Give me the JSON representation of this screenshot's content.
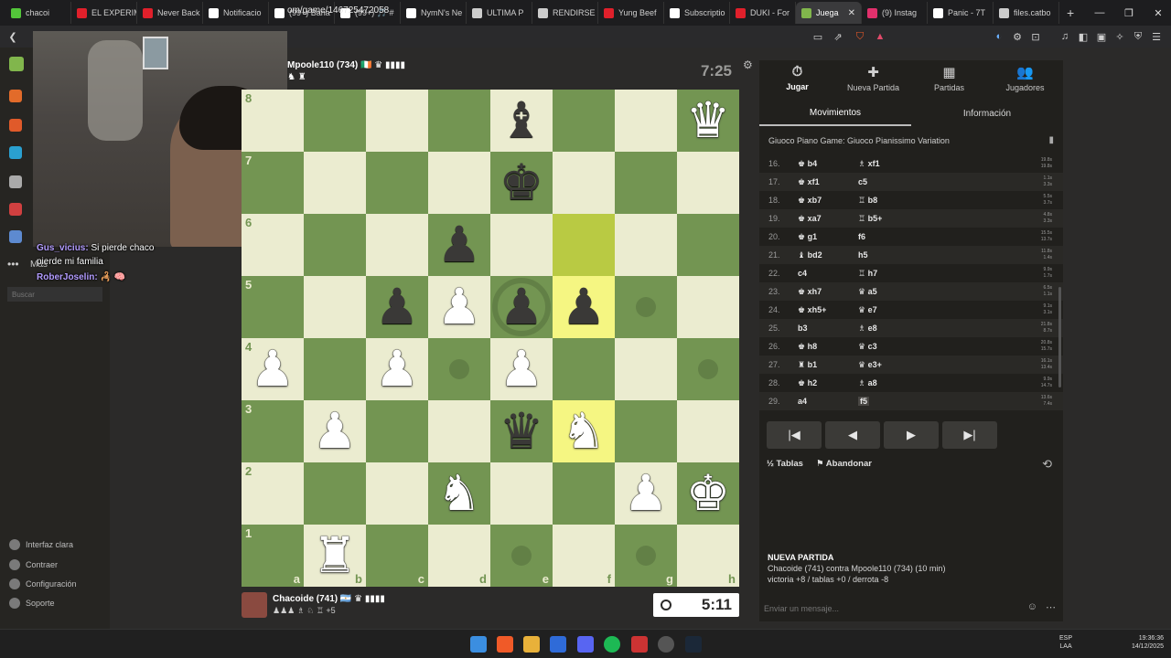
{
  "browser": {
    "tabs": [
      {
        "label": "chacoi",
        "color": "#53c53a"
      },
      {
        "label": "EL EXPERIM",
        "color": "#e0202b"
      },
      {
        "label": "Never Back",
        "color": "#e0202b"
      },
      {
        "label": "Notificacio",
        "color": "#ffffff"
      },
      {
        "label": "(99+) Bana",
        "color": "#ffffff"
      },
      {
        "label": "(99+) 🎵 #",
        "color": "#ffffff"
      },
      {
        "label": "NymN's Ne",
        "color": "#ffffff"
      },
      {
        "label": "ULTIMA P",
        "color": "#cccccc"
      },
      {
        "label": "RENDIRSE",
        "color": "#cccccc"
      },
      {
        "label": "Yung Beef",
        "color": "#e0202b"
      },
      {
        "label": "Subscriptio",
        "color": "#ffffff"
      },
      {
        "label": "DUKI - For",
        "color": "#e0202b"
      },
      {
        "label": "Juega",
        "color": "#81b64c",
        "active": true
      },
      {
        "label": "(9) Instag",
        "color": "#e1306c"
      },
      {
        "label": "Panic - 7T",
        "color": "#ffffff"
      },
      {
        "label": "files.catbo",
        "color": "#cccccc"
      }
    ],
    "url": "om/game/146725472058"
  },
  "stream_chat": [
    {
      "user": "Gus_vicius:",
      "text": "Si pierde chaco"
    },
    {
      "user": "",
      "text": "pierde mi familia"
    },
    {
      "user": "RoberJoselin:",
      "text": "🦂 🧠"
    }
  ],
  "sidebar": {
    "more_label": "Más",
    "search_placeholder": "Buscar",
    "bottom": [
      "Interfaz clara",
      "Contraer",
      "Configuración",
      "Soporte"
    ]
  },
  "opponent": {
    "name": "Mpoole110 (734)",
    "flag": "🇮🇪 ♛ ▮▮▮▮",
    "captured": "♞ ♜",
    "clock": "7:25"
  },
  "player": {
    "name": "Chacoide (741)",
    "flag": "🇦🇷 ♛ ▮▮▮▮",
    "captured": "♟♟♟ ♗ ♘ ♖ +5",
    "clock": "5:11"
  },
  "board": {
    "ranks": [
      "8",
      "7",
      "6",
      "5",
      "4",
      "3",
      "2",
      "1"
    ],
    "files": [
      "a",
      "b",
      "c",
      "d",
      "e",
      "f",
      "g",
      "h"
    ],
    "pieces": [
      [
        "",
        "",
        "",
        "",
        "b-b",
        "",
        "",
        "w-q"
      ],
      [
        "",
        "",
        "",
        "",
        "b-k",
        "",
        "",
        ""
      ],
      [
        "",
        "",
        "",
        "b-p",
        "",
        "",
        "",
        ""
      ],
      [
        "",
        "",
        "b-p",
        "w-p",
        "b-p",
        "b-p",
        "",
        ""
      ],
      [
        "w-p",
        "",
        "w-p",
        "",
        "w-p",
        "",
        "",
        ""
      ],
      [
        "",
        "w-p",
        "",
        "",
        "b-q",
        "w-n",
        "",
        ""
      ],
      [
        "",
        "",
        "",
        "w-n",
        "",
        "",
        "w-p",
        "w-k"
      ],
      [
        "",
        "w-r",
        "",
        "",
        "",
        "",
        "",
        ""
      ]
    ],
    "highlights": [
      "f6",
      "f5",
      "f3"
    ],
    "move_dots": [
      "g5",
      "d4",
      "h4",
      "e1",
      "g1"
    ],
    "capture_rings": [
      "e5"
    ]
  },
  "panel": {
    "tabs": [
      {
        "label": "Jugar",
        "icon": "⏱",
        "active": true
      },
      {
        "label": "Nueva Partida",
        "icon": "✚"
      },
      {
        "label": "Partidas",
        "icon": "▦"
      },
      {
        "label": "Jugadores",
        "icon": "👥"
      }
    ],
    "subtabs": [
      "Movimientos",
      "Información"
    ],
    "opening": "Giuoco Piano Game: Giuoco Pianissimo Variation",
    "moves": [
      {
        "n": "16.",
        "w": "♚ b4",
        "b": "♗ xf1",
        "t1": "19.8s",
        "t2": "19.8s"
      },
      {
        "n": "17.",
        "w": "♚ xf1",
        "b": "c5",
        "t1": "1.1s",
        "t2": "3.3s"
      },
      {
        "n": "18.",
        "w": "♚ xb7",
        "b": "♖ b8",
        "t1": "5.5s",
        "t2": "3.7s"
      },
      {
        "n": "19.",
        "w": "♚ xa7",
        "b": "♖ b5+",
        "t1": "4.8s",
        "t2": "3.3s"
      },
      {
        "n": "20.",
        "w": "♚ g1",
        "b": "f6",
        "t1": "15.5s",
        "t2": "13.7s"
      },
      {
        "n": "21.",
        "w": "♝ bd2",
        "b": "h5",
        "t1": "11.8s",
        "t2": "1.4s"
      },
      {
        "n": "22.",
        "w": "c4",
        "b": "♖ h7",
        "t1": "9.9s",
        "t2": "1.7s"
      },
      {
        "n": "23.",
        "w": "♚ xh7",
        "b": "♛ a5",
        "t1": "6.5s",
        "t2": "1.1s"
      },
      {
        "n": "24.",
        "w": "♚ xh5+",
        "b": "♛ e7",
        "t1": "9.1s",
        "t2": "3.1s"
      },
      {
        "n": "25.",
        "w": "b3",
        "b": "♗ e8",
        "t1": "21.8s",
        "t2": "8.7s"
      },
      {
        "n": "26.",
        "w": "♚ h8",
        "b": "♛ c3",
        "t1": "20.8s",
        "t2": "15.7s"
      },
      {
        "n": "27.",
        "w": "♜ b1",
        "b": "♛ e3+",
        "t1": "16.1s",
        "t2": "13.4s"
      },
      {
        "n": "28.",
        "w": "♚ h2",
        "b": "♗ a8",
        "t1": "9.9s",
        "t2": "14.7s"
      },
      {
        "n": "29.",
        "w": "a4",
        "b": "f5",
        "t1": "13.6s",
        "t2": "7.4s",
        "current": true
      }
    ],
    "nav": [
      "|◀",
      "◀",
      "▶",
      "▶|"
    ],
    "draw": "½  Tablas",
    "resign": "⚑  Abandonar",
    "flip": "⟲",
    "new_game": {
      "title": "NUEVA PARTIDA",
      "line1": "Chacoide (741) contra Mpoole110 (734) (10 min)",
      "line2": "victoria +8 / tablas +0 / derrota -8"
    },
    "chat_placeholder": "Enviar un mensaje..."
  },
  "taskbar": {
    "lang": "ESP\nLAA",
    "time": "19:36:36",
    "date": "14/12/2025"
  }
}
